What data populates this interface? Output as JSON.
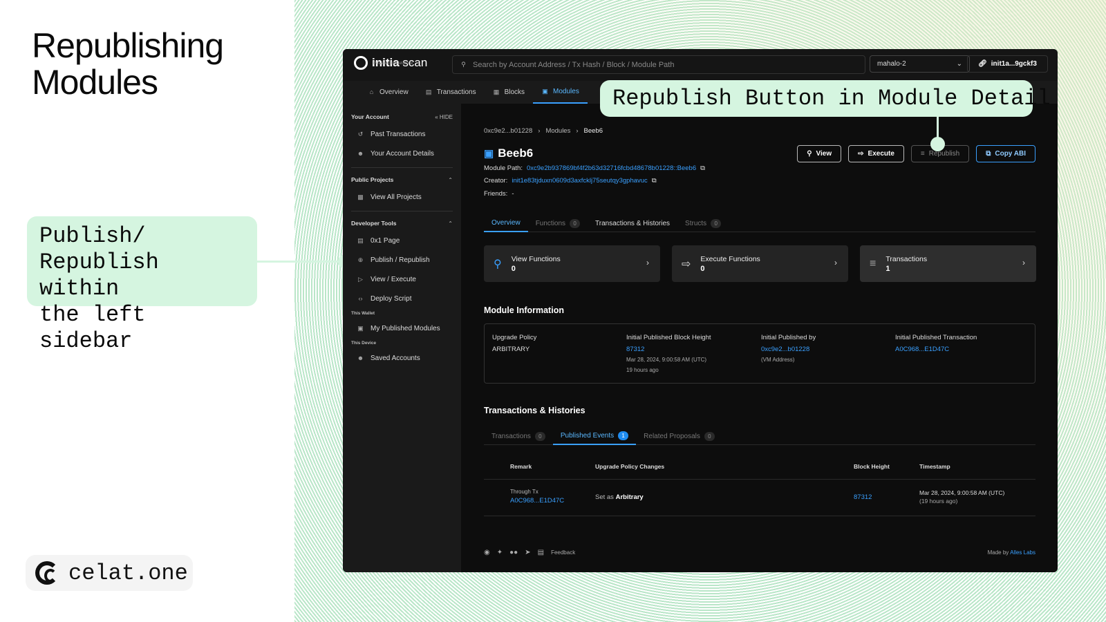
{
  "slide": {
    "title": "Republishing\nModules",
    "callout_left": "Publish/\nRepublish within\nthe left sidebar",
    "callout_top": "Republish Button in Module Detail",
    "brand": "celat.one"
  },
  "app": {
    "logo_main": "initia",
    "logo_scan": "scan",
    "logo_sub": "Powered by Celatone",
    "search_placeholder": "Search by Account Address / Tx Hash / Block / Module Path",
    "network": "mahalo-2",
    "account": "init1a...9gckf3",
    "nav": [
      "Overview",
      "Transactions",
      "Blocks",
      "Modules"
    ],
    "sidebar": {
      "your_account": "Your Account",
      "hide": "HIDE",
      "past_transactions": "Past Transactions",
      "account_details": "Your Account Details",
      "public_projects": "Public Projects",
      "view_all_projects": "View All Projects",
      "developer_tools": "Developer Tools",
      "page_0x1": "0x1 Page",
      "publish_republish": "Publish / Republish",
      "view_execute": "View / Execute",
      "deploy_script": "Deploy Script",
      "this_wallet": "This Wallet",
      "my_published_modules": "My Published Modules",
      "this_device": "This Device",
      "saved_accounts": "Saved Accounts"
    },
    "breadcrumb": [
      "0xc9e2...b01228",
      "Modules",
      "Beeb6"
    ],
    "module_name": "Beeb6",
    "module_path_label": "Module Path:",
    "module_path": "0xc9e2b937869bf4f2b63d32716fcbd48678b01228::Beeb6",
    "creator_label": "Creator:",
    "creator": "init1e83tjduxn0609d3axfcklj75seutqy3gphavuc",
    "friends_label": "Friends:",
    "friends": "-",
    "buttons": {
      "view": "View",
      "execute": "Execute",
      "republish": "Republish",
      "copy_abi": "Copy ABI"
    },
    "tabs": [
      {
        "label": "Overview"
      },
      {
        "label": "Functions",
        "count": "0"
      },
      {
        "label": "Transactions & Histories"
      },
      {
        "label": "Structs",
        "count": "0"
      }
    ],
    "cards": [
      {
        "label": "View Functions",
        "value": "0"
      },
      {
        "label": "Execute Functions",
        "value": "0"
      },
      {
        "label": "Transactions",
        "value": "1"
      }
    ],
    "module_info_title": "Module Information",
    "module_info": {
      "upgrade_policy_label": "Upgrade Policy",
      "upgrade_policy": "ARBITRARY",
      "block_height_label": "Initial Published Block Height",
      "block_height": "87312",
      "block_time": "Mar 28, 2024, 9:00:58 AM (UTC)",
      "block_ago": "19 hours ago",
      "published_by_label": "Initial Published by",
      "published_by": "0xc9e2...b01228",
      "published_by_sub": "(VM Address)",
      "published_tx_label": "Initial Published Transaction",
      "published_tx": "A0C968...E1D47C"
    },
    "histories_title": "Transactions & Histories",
    "history_tabs": [
      {
        "label": "Transactions",
        "count": "0"
      },
      {
        "label": "Published Events",
        "count": "1"
      },
      {
        "label": "Related Proposals",
        "count": "0"
      }
    ],
    "table_headers": [
      "Remark",
      "Upgrade Policy Changes",
      "Block Height",
      "Timestamp"
    ],
    "row": {
      "remark_label": "Through Tx",
      "remark_tx": "A0C968...E1D47C",
      "policy_prefix": "Set as",
      "policy_value": "Arbitrary",
      "block_height": "87312",
      "timestamp": "Mar 28, 2024, 9:00:58 AM (UTC)",
      "ago": "(19 hours ago)"
    },
    "footer": {
      "feedback": "Feedback",
      "made_by": "Made by",
      "made_by_link": "Alles Labs"
    }
  }
}
